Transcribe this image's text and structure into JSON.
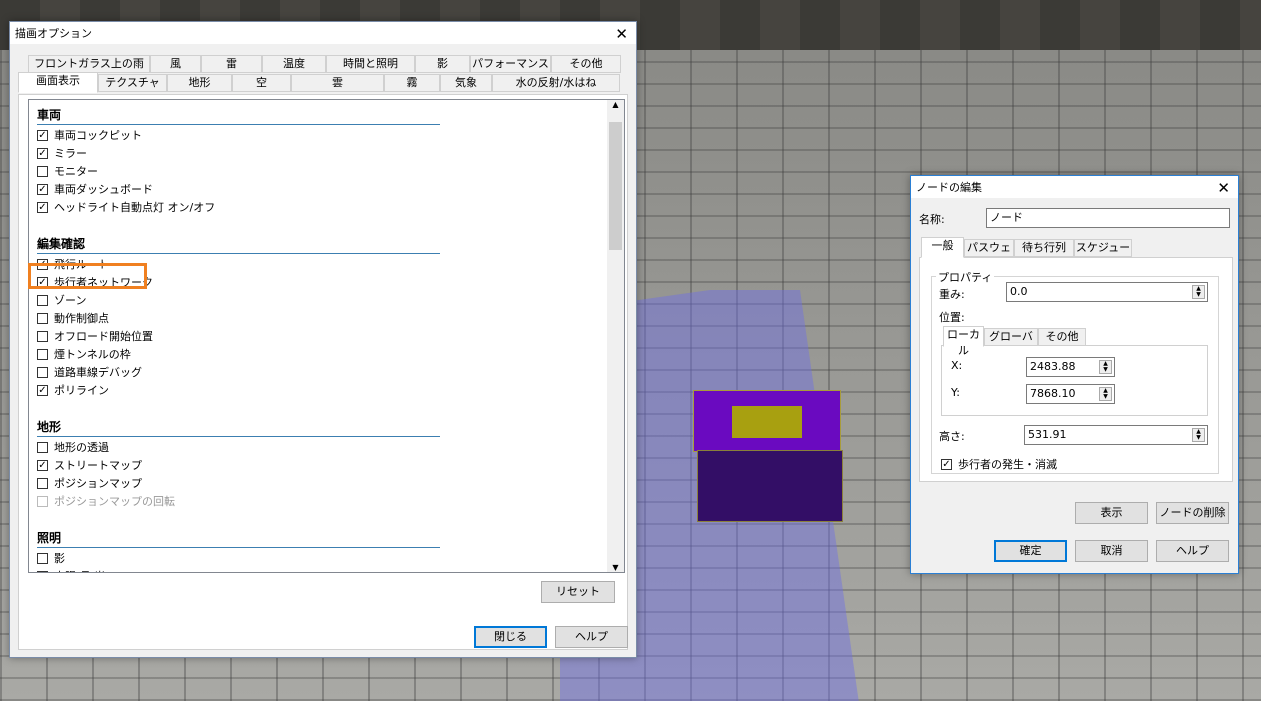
{
  "render_dialog": {
    "title": "描画オプション",
    "tabs_row1": [
      "フロントガラス上の雨水",
      "風",
      "雷",
      "温度",
      "時間と照明",
      "影",
      "パフォーマンス",
      "その他"
    ],
    "tabs_row2": [
      "画面表示",
      "テクスチャ",
      "地形",
      "空",
      "雲",
      "霧",
      "気象",
      "水の反射/水はね"
    ],
    "sections": [
      {
        "title": "車両",
        "items": [
          {
            "label": "車両コックピット",
            "checked": true
          },
          {
            "label": "ミラー",
            "checked": true
          },
          {
            "label": "モニター",
            "checked": false
          },
          {
            "label": "車両ダッシュボード",
            "checked": true
          },
          {
            "label": "ヘッドライト自動点灯 オン/オフ",
            "checked": true
          }
        ]
      },
      {
        "title": "編集確認",
        "items": [
          {
            "label": "飛行ルート",
            "checked": true
          },
          {
            "label": "歩行者ネットワーク",
            "checked": true
          },
          {
            "label": "ゾーン",
            "checked": false
          },
          {
            "label": "動作制御点",
            "checked": false
          },
          {
            "label": "オフロード開始位置",
            "checked": false
          },
          {
            "label": "煙トンネルの枠",
            "checked": false
          },
          {
            "label": "道路車線デバッグ",
            "checked": false
          },
          {
            "label": "ポリライン",
            "checked": true
          }
        ]
      },
      {
        "title": "地形",
        "items": [
          {
            "label": "地形の透過",
            "checked": false
          },
          {
            "label": "ストリートマップ",
            "checked": true
          },
          {
            "label": "ポジションマップ",
            "checked": false
          },
          {
            "label": "ポジションマップの回転",
            "checked": false,
            "disabled": true
          }
        ]
      },
      {
        "title": "照明",
        "items": [
          {
            "label": "影",
            "checked": false
          },
          {
            "label": "太陽/月 光",
            "checked": true
          }
        ]
      }
    ],
    "reset": "リセット",
    "close": "閉じる",
    "help": "ヘルプ"
  },
  "node_dialog": {
    "title": "ノードの編集",
    "name_label": "名称:",
    "name_value": "ノード",
    "tabs": [
      "一般",
      "パスウェイ",
      "待ち行列",
      "スケジュール"
    ],
    "group_label": "プロパティ",
    "weight_label": "重み:",
    "weight_value": "0.0",
    "position_label": "位置:",
    "pos_tabs": [
      "ローカル",
      "グローバル",
      "その他"
    ],
    "x_label": "X:",
    "x_value": "2483.88",
    "y_label": "Y:",
    "y_value": "7868.10",
    "height_label": "高さ:",
    "height_value": "531.91",
    "spawn_label": "歩行者の発生・消滅",
    "spawn_checked": true,
    "show": "表示",
    "delete": "ノードの削除",
    "ok": "確定",
    "cancel": "取消",
    "help": "ヘルプ"
  }
}
